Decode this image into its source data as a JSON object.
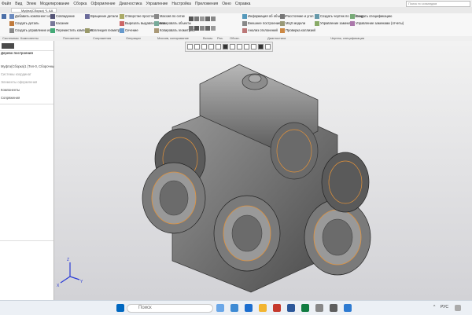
{
  "menu": [
    "Файл",
    "Вид",
    "Элем",
    "Моделирование",
    "Сборка",
    "Оформление",
    "Диагностика",
    "Управление",
    "Настройка",
    "Приложения",
    "Окно",
    "Справка"
  ],
  "menu_search_placeholder": "Поиск по командам",
  "doc_tab": "Муфта(Сборка) *1 АА",
  "ribbon": {
    "c1": [
      "Добавить компонент из...",
      "Создать деталь",
      "Создать управление из..."
    ],
    "c2": [
      "Совпадение",
      "Касание",
      "Переместить компонент"
    ],
    "c3": [
      "Вращение детали",
      "",
      "Коллекция геометрии"
    ],
    "c4": [
      "Отверстие простое",
      "Вырезать выдавливанием",
      "Сечение"
    ],
    "c5": [
      "Массив по сетке",
      "Копировать объекты",
      "Копировать геометрию"
    ],
    "c6": [
      "Информация об объекте",
      "Внешнее построение",
      "Анализ отклонений"
    ],
    "c7": [
      "Расстояние и угол",
      "МЦХ модели",
      "Проверка коллизий"
    ],
    "c8": [
      "Создать чертеж по шаблону",
      "Управление заменами",
      ""
    ],
    "c9": [
      "Создать спецификацию",
      "Управление заменами (отчеты)"
    ]
  },
  "ribbon_groups": [
    "Системная",
    "Компоненты",
    "Положение",
    "Сопряжения",
    "Операции",
    "Массив, копирование",
    "Вспом.",
    "Раз.",
    "Обозн.",
    "Диагностика",
    "Чертеж, спецификация"
  ],
  "left_panel": {
    "rows": [
      "Дерево построения",
      "Муфта(Сборка)1 (Тел-0, Сборочные)",
      "Системы координат",
      "Элементы оформления",
      "Компоненты",
      "Сопряжения"
    ]
  },
  "taskbar": {
    "search_placeholder": "Поиск",
    "lang": "РУС",
    "colors": {
      "bar": "#ecf0f5",
      "accent": "#0067c0"
    }
  },
  "triad": {
    "x": "X",
    "y": "Y",
    "z": "Z"
  }
}
